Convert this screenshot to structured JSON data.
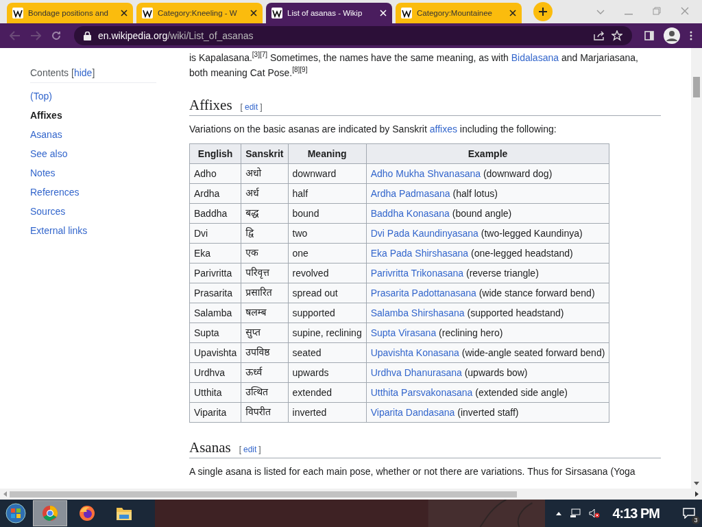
{
  "browser": {
    "tabs": [
      {
        "title": "Bondage positions and",
        "selected": false
      },
      {
        "title": "Category:Kneeling - W",
        "selected": false
      },
      {
        "title": "List of asanas - Wikip",
        "selected": true
      },
      {
        "title": "Category:Mountainee",
        "selected": false
      }
    ],
    "url": {
      "host": "en.wikipedia.org",
      "path": "/wiki/List_of_asanas"
    }
  },
  "sidebar": {
    "title": "Contents",
    "hide": {
      "open": "[",
      "label": "hide",
      "close": "]"
    },
    "items": [
      {
        "label": "(Top)",
        "selected": false
      },
      {
        "label": "Affixes",
        "selected": true
      },
      {
        "label": "Asanas",
        "selected": false
      },
      {
        "label": "See also",
        "selected": false
      },
      {
        "label": "Notes",
        "selected": false
      },
      {
        "label": "References",
        "selected": false
      },
      {
        "label": "Sources",
        "selected": false
      },
      {
        "label": "External links",
        "selected": false
      }
    ]
  },
  "intro": [
    {
      "kind": "text",
      "text": "is Kapalasana.$^{[3][7]}$ Sometimes, the names have the same meaning, as with"
    },
    {
      "kind": "link",
      "text": "Bidalasana"
    },
    {
      "kind": "text",
      "text": "and Marjariasana, both meaning Cat Pose.$^{[8][9]}$"
    }
  ],
  "sections": [
    {
      "heading": "Affixes",
      "edit": {
        "open": "[",
        "label": "edit",
        "close": "]"
      },
      "paragraph": [
        {
          "kind": "text",
          "text": "Variations on the basic asanas are indicated by Sanskrit"
        },
        {
          "kind": "link",
          "text": "affixes"
        },
        {
          "kind": "text",
          "text": "including the following:"
        }
      ],
      "table": {
        "columns": [
          "English",
          "Sanskrit",
          "Meaning",
          "Example"
        ],
        "rows": [
          {
            "english": "Adho",
            "sanskrit": "अधो",
            "meaning": "downward",
            "example_link": "Adho Mukha Shvanasana",
            "example_note": "(downward dog)"
          },
          {
            "english": "Ardha",
            "sanskrit": "अर्ध",
            "meaning": "half",
            "example_link": "Ardha Padmasana",
            "example_note": "(half lotus)"
          },
          {
            "english": "Baddha",
            "sanskrit": "बद्ध",
            "meaning": "bound",
            "example_link": "Baddha Konasana",
            "example_note": "(bound angle)"
          },
          {
            "english": "Dvi",
            "sanskrit": "द्वि",
            "meaning": "two",
            "example_link": "Dvi Pada Kaundinyasana",
            "example_note": "(two-legged Kaundinya)"
          },
          {
            "english": "Eka",
            "sanskrit": "एक",
            "meaning": "one",
            "example_link": "Eka Pada Shirshasana",
            "example_note": "(one-legged headstand)"
          },
          {
            "english": "Parivritta",
            "sanskrit": "परिवृत्त",
            "meaning": "revolved",
            "example_link": "Parivritta Trikonasana",
            "example_note": "(reverse triangle)"
          },
          {
            "english": "Prasarita",
            "sanskrit": "प्रसारित",
            "meaning": "spread out",
            "example_link": "Prasarita Padottanasana",
            "example_note": "(wide stance forward bend)"
          },
          {
            "english": "Salamba",
            "sanskrit": "षलम्ब",
            "meaning": "supported",
            "example_link": "Salamba Shirshasana",
            "example_note": "(supported headstand)"
          },
          {
            "english": "Supta",
            "sanskrit": "सुप्त",
            "meaning": "supine, reclining",
            "example_link": "Supta Virasana",
            "example_note": "(reclining hero)"
          },
          {
            "english": "Upavishta",
            "sanskrit": "उपविष्ठ",
            "meaning": "seated",
            "example_link": "Upavishta Konasana",
            "example_note": "(wide-angle seated forward bend)"
          },
          {
            "english": "Urdhva",
            "sanskrit": "ऊर्ध्व",
            "meaning": "upwards",
            "example_link": "Urdhva Dhanurasana",
            "example_note": "(upwards bow)"
          },
          {
            "english": "Utthita",
            "sanskrit": "उत्थित",
            "meaning": "extended",
            "example_link": "Utthita Parsvakonasana",
            "example_note": "(extended side angle)"
          },
          {
            "english": "Viparita",
            "sanskrit": "विपरीत",
            "meaning": "inverted",
            "example_link": "Viparita Dandasana",
            "example_note": "(inverted staff)"
          }
        ]
      }
    },
    {
      "heading": "Asanas",
      "edit": {
        "open": "[",
        "label": "edit",
        "close": "]"
      },
      "paragraph": [
        {
          "kind": "text",
          "text": "A single asana is listed for each main pose, whether or not there are variations. Thus for Sirsasana (Yoga"
        }
      ]
    }
  ],
  "taskbar": {
    "apps": [
      {
        "kind": "chrome",
        "selected": true
      },
      {
        "kind": "firefox",
        "selected": false
      },
      {
        "kind": "folder",
        "selected": false
      }
    ],
    "time": "4:13 PM",
    "notifications": "3"
  }
}
